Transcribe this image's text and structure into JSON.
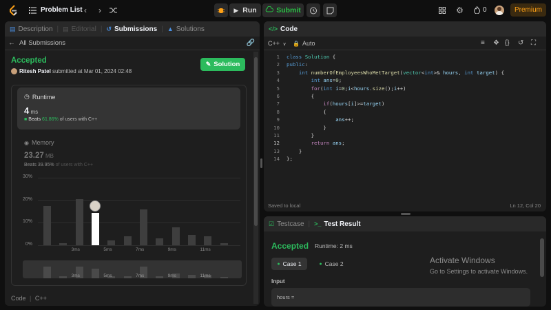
{
  "topbar": {
    "problem_list": "Problem List",
    "run": "Run",
    "submit": "Submit",
    "streak_count": "0",
    "premium": "Premium"
  },
  "left_tabs": {
    "description": "Description",
    "editorial": "Editorial",
    "submissions": "Submissions",
    "solutions": "Solutions"
  },
  "submission": {
    "back_label": "All Submissions",
    "status": "Accepted",
    "user": "Ritesh Patel",
    "submitted_text": "submitted at Mar 01, 2024 02:48",
    "solution_button": "Solution",
    "runtime_title": "Runtime",
    "runtime_value": "4",
    "runtime_unit": "ms",
    "runtime_beats_prefix": "Beats",
    "runtime_beats_pct": "61.86%",
    "runtime_beats_suffix": "of users with C++",
    "memory_title": "Memory",
    "memory_value": "23.27",
    "memory_unit": "MB",
    "memory_beats_prefix": "Beats",
    "memory_beats_pct": "39.95%",
    "memory_beats_suffix": "of users with C++",
    "code_label": "Code",
    "code_lang": "C++"
  },
  "chart_data": {
    "type": "bar",
    "ylabels": [
      "30%",
      "20%",
      "10%",
      "0%"
    ],
    "xlabels": [
      "3ms",
      "5ms",
      "7ms",
      "9ms",
      "11ms"
    ],
    "mini_xlabels": [
      "3ms",
      "5ms",
      "7ms",
      "9ms",
      "11ms"
    ],
    "ylim": [
      0,
      30
    ],
    "values": [
      17.5,
      1,
      20.5,
      14.5,
      2,
      4,
      16,
      3,
      8,
      4.5,
      4,
      1
    ],
    "highlight_index": 3,
    "mini_values": [
      5,
      1,
      5,
      4,
      1,
      1,
      5,
      1,
      2,
      1.5,
      1.5,
      0.5
    ]
  },
  "code": {
    "title": "Code",
    "language": "C++",
    "mode": "Auto",
    "saved": "Saved to local",
    "cursor": "Ln 12, Col 20",
    "lines": [
      {
        "n": "1",
        "html": "<span class='kw'>class</span> <span class='ty'>Solution</span> <span class='pl'>{</span>"
      },
      {
        "n": "2",
        "html": "<span class='kw'>public</span><span class='pl'>:</span>"
      },
      {
        "n": "3",
        "html": "    <span class='kw'>int</span> <span class='fn'>numberOfEmployeesWhoMetTarget</span><span class='pl'>(</span><span class='ty'>vector</span><span class='pl'>&lt;</span><span class='kw'>int</span><span class='pl'>&gt;&amp;</span> <span class='vr'>hours</span><span class='pl'>,</span> <span class='kw'>int</span> <span class='vr'>target</span><span class='pl'>) {</span>"
      },
      {
        "n": "4",
        "html": "        <span class='kw'>int</span> <span class='vr'>ans</span><span class='pl'>=</span><span class='nm'>0</span><span class='pl'>;</span>"
      },
      {
        "n": "5",
        "html": "        <span class='kw2'>for</span><span class='pl'>(</span><span class='kw'>int</span> <span class='vr'>i</span><span class='pl'>=</span><span class='nm'>0</span><span class='pl'>;</span><span class='vr'>i</span><span class='pl'>&lt;</span><span class='vr'>hours</span><span class='pl'>.</span><span class='fn'>size</span><span class='pl'>();</span><span class='vr'>i</span><span class='pl'>++)</span>"
      },
      {
        "n": "6",
        "html": "        <span class='pl'>{</span>"
      },
      {
        "n": "7",
        "html": "            <span class='kw2'>if</span><span class='pl'>(</span><span class='vr'>hours</span><span class='pl'>[</span><span class='vr'>i</span><span class='pl'>]&gt;=</span><span class='vr'>target</span><span class='pl'>)</span>"
      },
      {
        "n": "8",
        "html": "            <span class='pl'>{</span>"
      },
      {
        "n": "9",
        "html": "                <span class='vr'>ans</span><span class='pl'>++;</span>"
      },
      {
        "n": "10",
        "html": "            <span class='pl'>}</span>"
      },
      {
        "n": "11",
        "html": "        <span class='pl'>}</span>"
      },
      {
        "n": "12",
        "html": "        <span class='kw2'>return</span> <span class='vr'>ans</span><span class='pl'>;</span>"
      },
      {
        "n": "13",
        "html": "    <span class='pl'>}</span>"
      },
      {
        "n": "14",
        "html": "<span class='pl'>};</span>"
      }
    ]
  },
  "result": {
    "testcase_tab": "Testcase",
    "result_tab": "Test Result",
    "status": "Accepted",
    "runtime": "Runtime: 2 ms",
    "case1": "Case 1",
    "case2": "Case 2",
    "input_label": "Input",
    "input_var": "hours ="
  },
  "watermark": {
    "title": "Activate Windows",
    "subtitle": "Go to Settings to activate Windows."
  },
  "colors": {
    "accent_green": "#2cbb5d",
    "premium": "#ffa116",
    "submit_green": "#28c244"
  }
}
